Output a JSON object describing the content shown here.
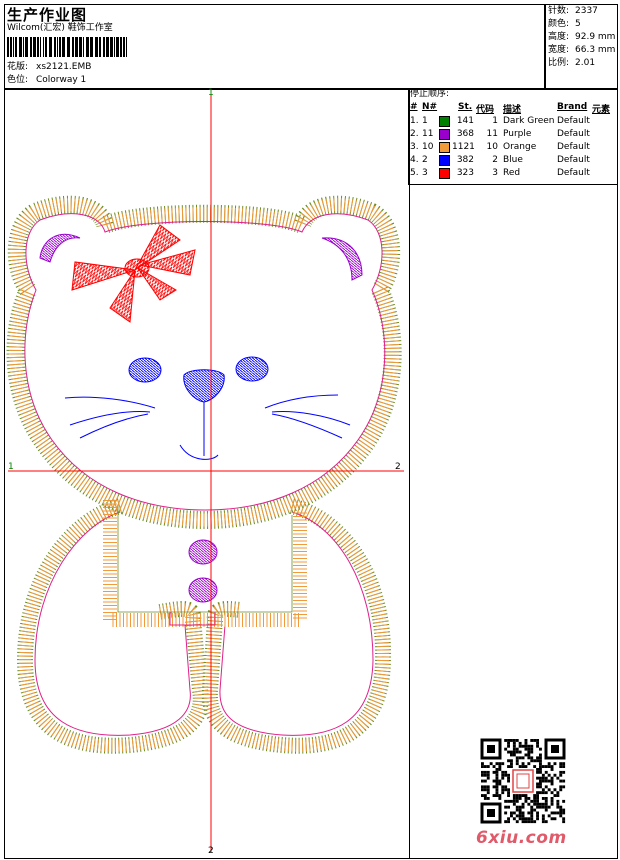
{
  "header": {
    "title": "生产作业图",
    "software": "Wilcom(汇宏) 鞋饰工作室",
    "design_label": "花版:",
    "design_value": "xs2121.EMB",
    "colorway_label": "色位:",
    "colorway_value": "Colorway 1"
  },
  "stats": {
    "stitches_label": "针数:",
    "stitches": "2337",
    "colors_label": "颜色:",
    "colors": "5",
    "height_label": "高度:",
    "height": "92.9 mm",
    "width_label": "宽度:",
    "width": "66.3 mm",
    "ratio_label": "比例:",
    "ratio": "2.01"
  },
  "stop_sequence": {
    "title": "停止顺序:",
    "columns": [
      "#",
      "N#",
      "St.",
      "代码",
      "描述",
      "Brand",
      "元素"
    ],
    "rows": [
      {
        "idx": "1.",
        "n": "1",
        "color": "#008000",
        "st": "141",
        "code": "1",
        "desc": "Dark Green",
        "brand": "Default"
      },
      {
        "idx": "2.",
        "n": "11",
        "color": "#9900cc",
        "st": "368",
        "code": "11",
        "desc": "Purple",
        "brand": "Default"
      },
      {
        "idx": "3.",
        "n": "10",
        "color": "#f09a3a",
        "st": "1121",
        "code": "10",
        "desc": "Orange",
        "brand": "Default"
      },
      {
        "idx": "4.",
        "n": "2",
        "color": "#0000ff",
        "st": "382",
        "code": "2",
        "desc": "Blue",
        "brand": "Default"
      },
      {
        "idx": "5.",
        "n": "3",
        "color": "#ff0000",
        "st": "323",
        "code": "3",
        "desc": "Red",
        "brand": "Default"
      }
    ]
  },
  "axis_markers": {
    "top": "1",
    "left": "1",
    "right": "2",
    "bottom": "2"
  },
  "watermark": "6xiu.com",
  "colors": {
    "orange": "#f09a3a",
    "green": "#6b8e23",
    "purple": "#9900cc",
    "blue": "#0000ff",
    "red": "#ff0000",
    "pink": "#e0208a",
    "axis": "#ff0000"
  }
}
